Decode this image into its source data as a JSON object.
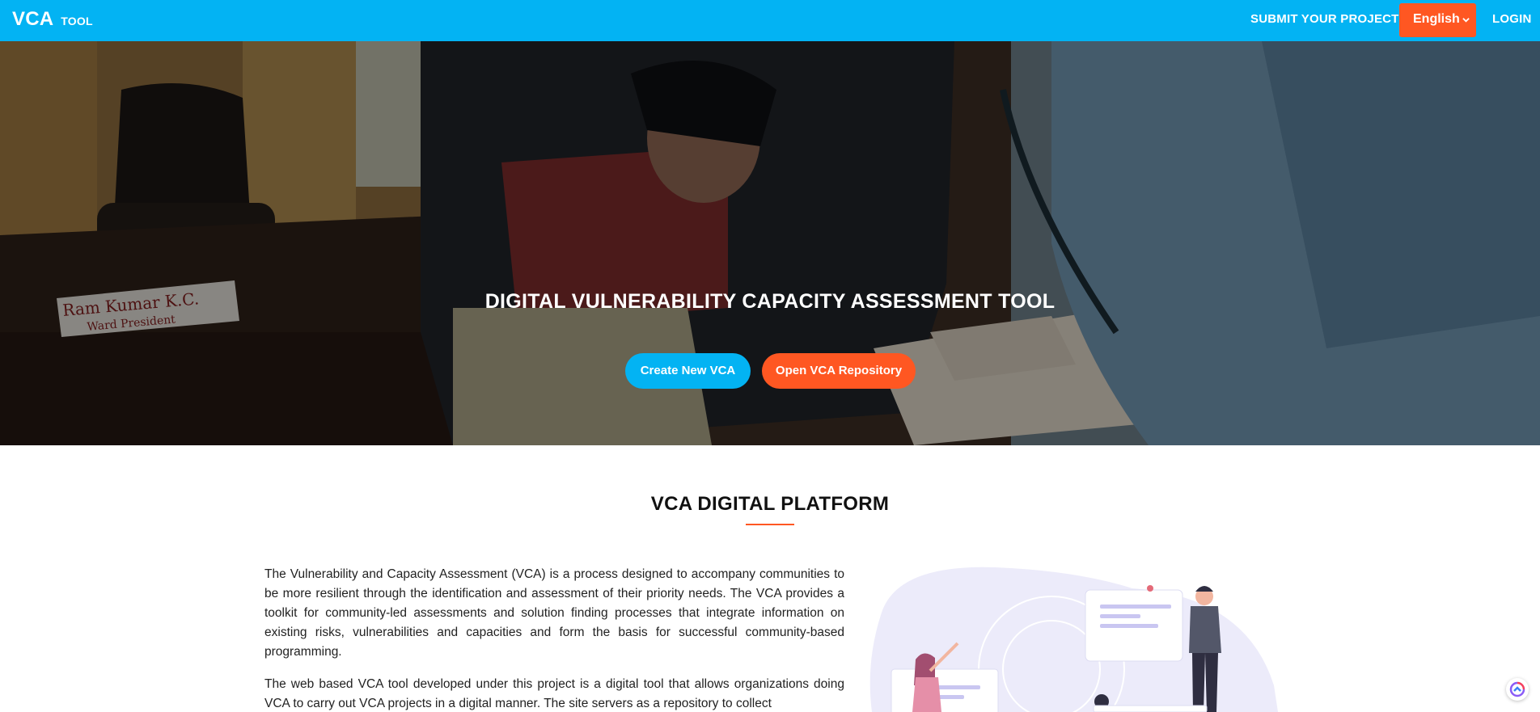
{
  "navbar": {
    "brand_main": "VCA",
    "brand_sub": "TOOL",
    "submit_label": "SUBMIT YOUR PROJECT",
    "language_selected": "English",
    "login_label": "LOGIN"
  },
  "hero": {
    "title": "DIGITAL VULNERABILITY CAPACITY ASSESSMENT TOOL",
    "create_button": "Create New VCA",
    "open_button": "Open VCA Repository",
    "photo_sign_name": "Ram Kumar K.C.",
    "photo_sign_role": "Ward President"
  },
  "about": {
    "title": "VCA DIGITAL PLATFORM",
    "paragraph_1": "The Vulnerability and Capacity Assessment (VCA) is a process designed to accompany communities to be more resilient through the identification and assessment of their priority needs. The VCA provides a toolkit for community-led assessments and solution finding processes that integrate information on existing risks, vulnerabilities and capacities and form the basis for successful community-based programming.",
    "paragraph_2": "The web based VCA tool developed under this project is a digital tool that allows organizations doing VCA to carry out VCA projects in a digital manner. The site servers as a repository to collect"
  },
  "icons": {
    "language_chevron": "chevron-down-icon",
    "chat": "chat-widget-icon"
  },
  "colors": {
    "primary": "#03b3f3",
    "accent": "#ff5722"
  }
}
